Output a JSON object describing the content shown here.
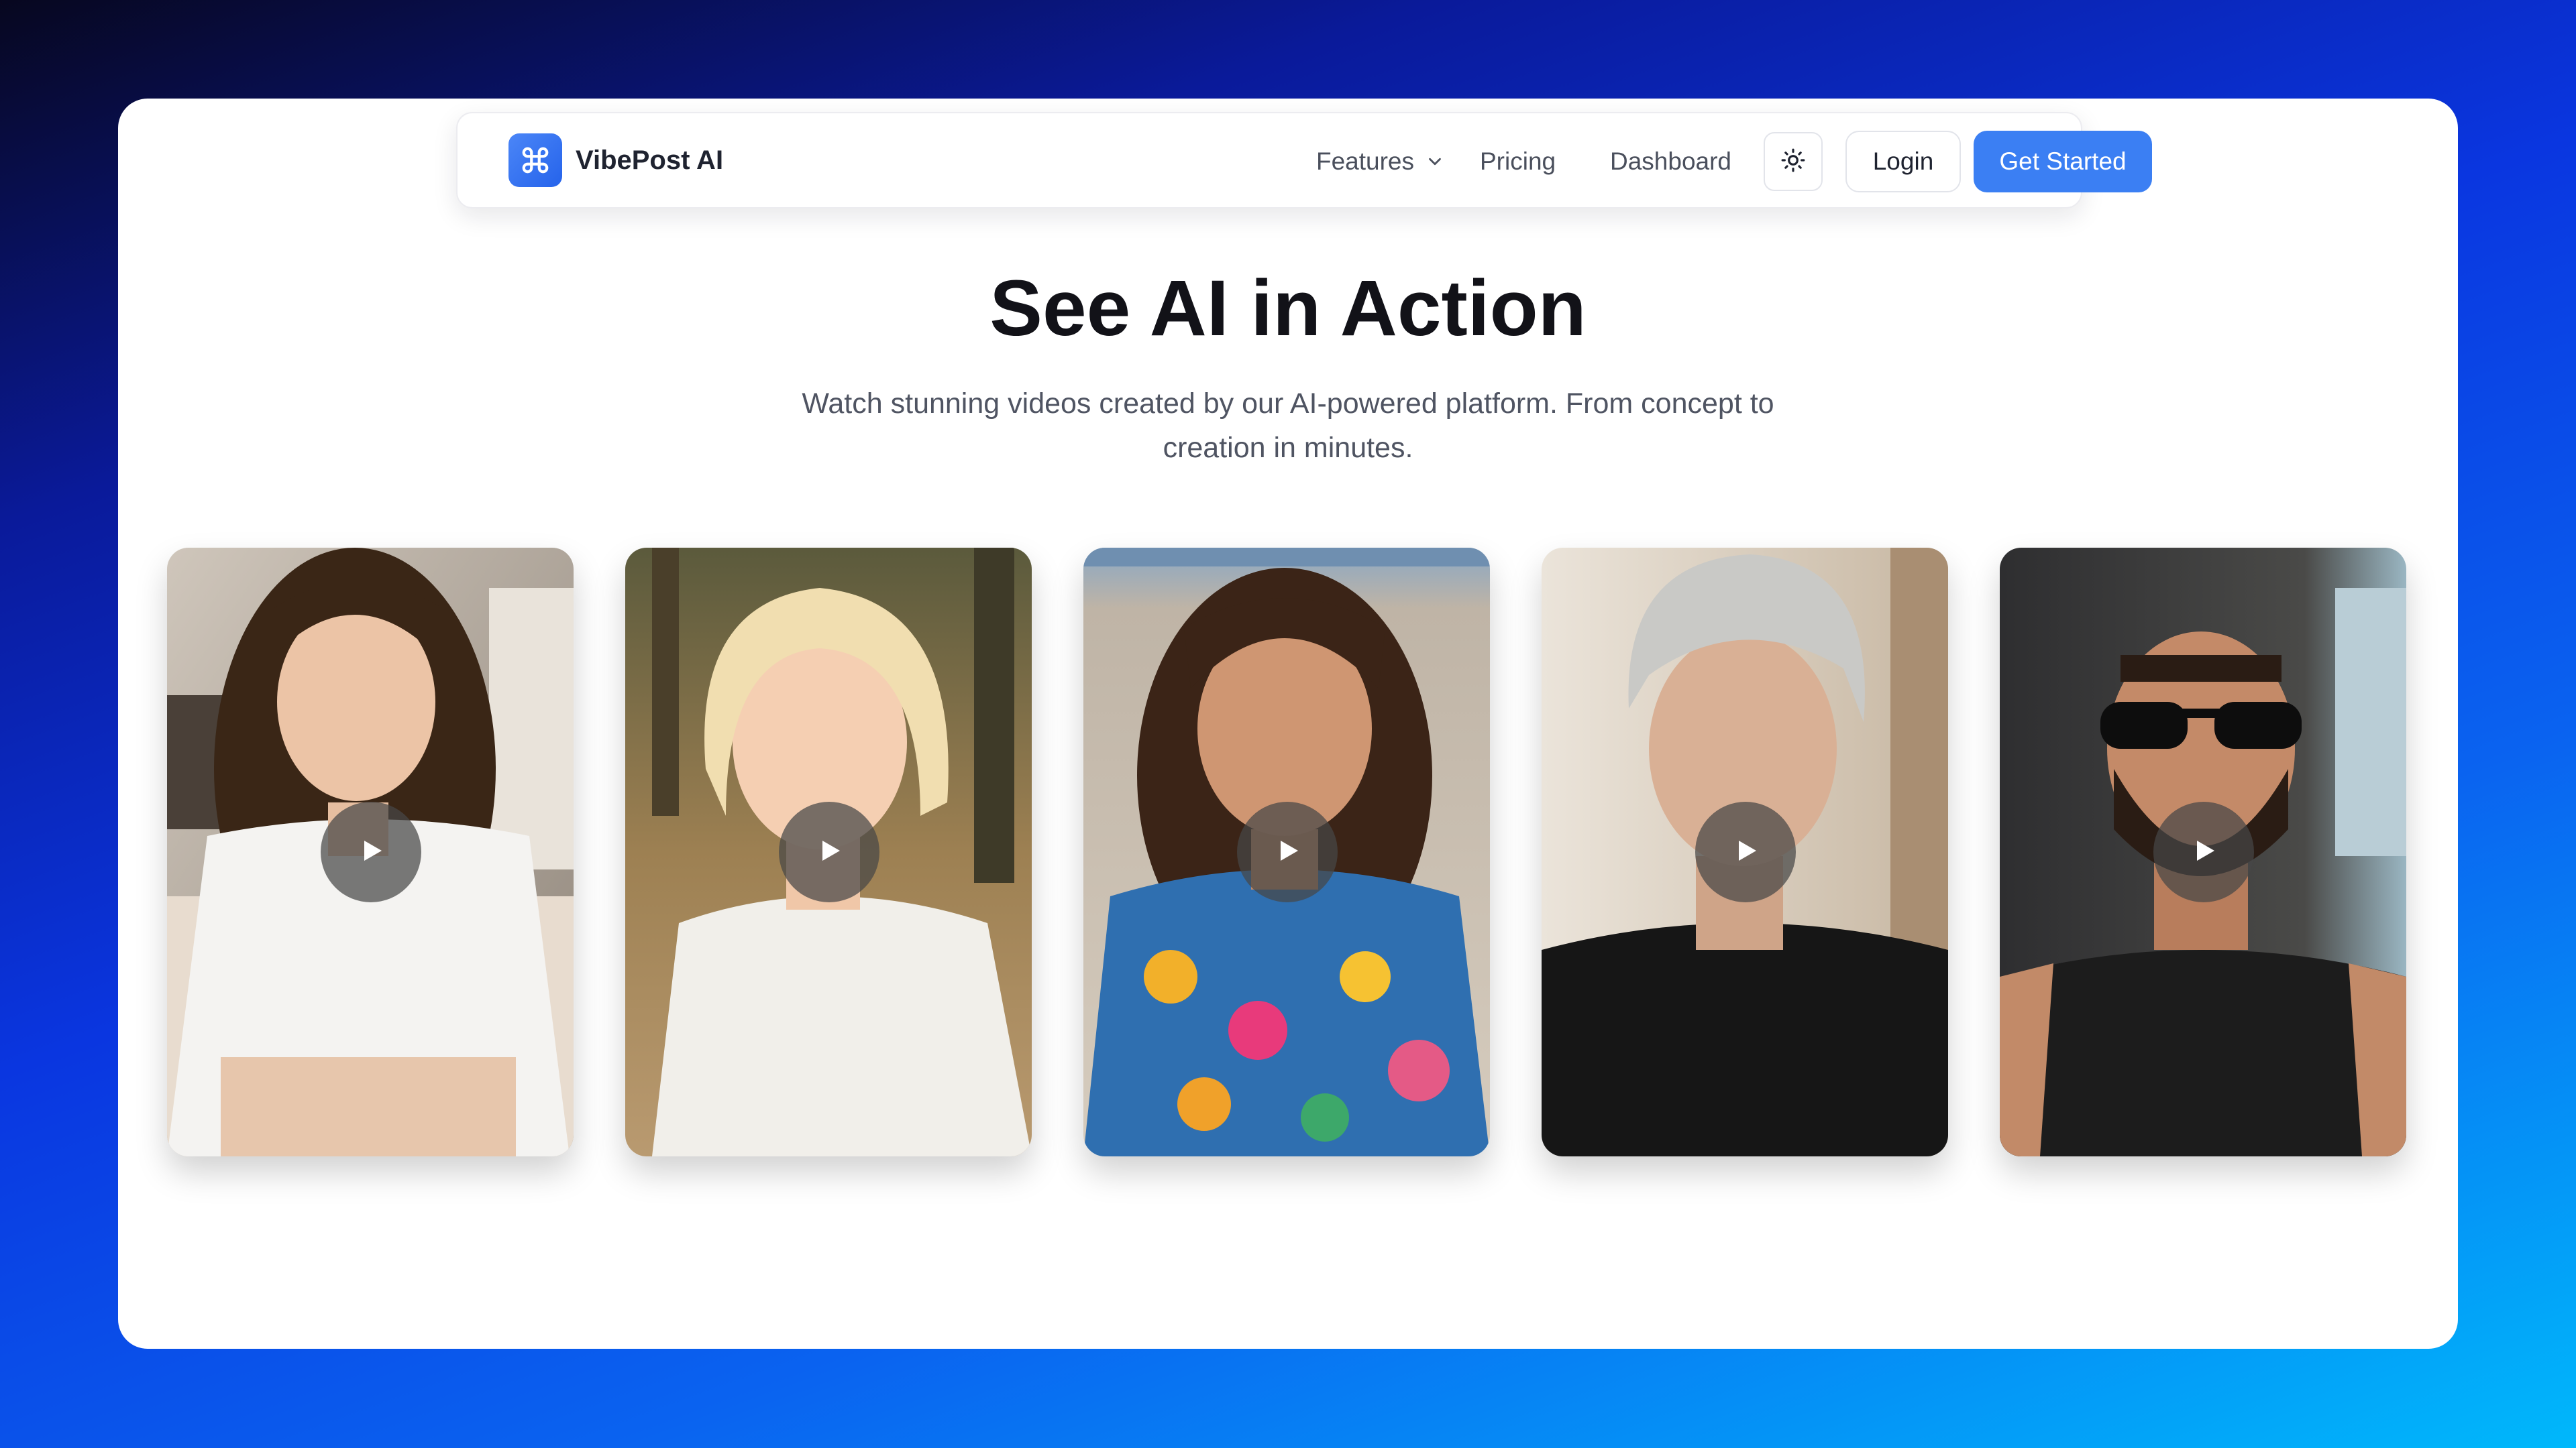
{
  "brand": {
    "name": "VibePost AI",
    "logo_icon": "command-icon",
    "accent_color": "#3b7ff3"
  },
  "nav": {
    "features_label": "Features",
    "features_icon": "chevron-down-icon",
    "pricing_label": "Pricing",
    "dashboard_label": "Dashboard",
    "theme_icon": "sun-icon",
    "login_label": "Login",
    "cta_label": "Get Started"
  },
  "hero": {
    "title": "See AI in Action",
    "subtitle": "Watch stunning videos created by our AI-powered platform. From concept to creation in minutes."
  },
  "videos": [
    {
      "play_icon": "play-icon"
    },
    {
      "play_icon": "play-icon"
    },
    {
      "play_icon": "play-icon"
    },
    {
      "play_icon": "play-icon"
    },
    {
      "play_icon": "play-icon"
    }
  ],
  "colors": {
    "page_gradient_start": "#07071f",
    "page_gradient_mid": "#0a36e0",
    "page_gradient_end": "#00b8fb",
    "title_color": "#121218",
    "text_muted": "#4f5462"
  }
}
